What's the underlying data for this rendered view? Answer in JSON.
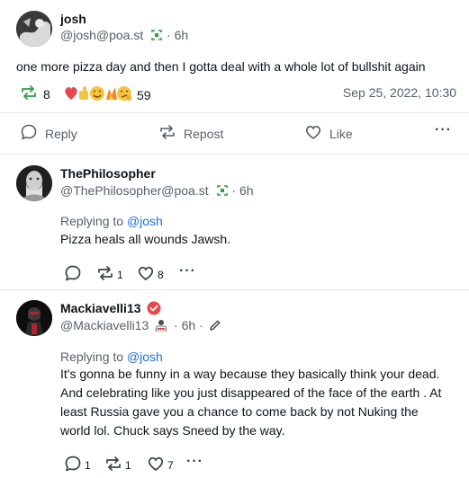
{
  "main_post": {
    "author_name": "josh",
    "author_handle": "@josh@poa.st",
    "age": "· 6h",
    "text": "one more pizza day and then I gotta deal with a whole lot of bullshit again",
    "repost_count": "8",
    "reaction_count": "59",
    "timestamp": "Sep 25, 2022, 10:30",
    "actions": {
      "reply": "Reply",
      "repost": "Repost",
      "like": "Like"
    }
  },
  "replies": [
    {
      "author_name": "ThePhilosopher",
      "author_handle": "@ThePhilosopher@poa.st",
      "age": "· 6h",
      "replying_prefix": "Replying to ",
      "replying_to": "@josh",
      "text": "Pizza heals all wounds Jawsh.",
      "reply_count": "",
      "repost_count": "1",
      "like_count": "8"
    },
    {
      "author_name": "Mackiavelli13",
      "author_handle": "@Mackiavelli13",
      "age": "· 6h ·",
      "replying_prefix": "Replying to ",
      "replying_to": "@josh",
      "text_lines": [
        "It's gonna be funny in a way because they basically think your dead.",
        "And celebrating like you just disappeared of the face of the earth . At",
        "least Russia gave you a chance to come back by not Nuking the",
        "world lol. Chuck says Sneed by the way."
      ],
      "reply_count": "1",
      "repost_count": "1",
      "like_count": "7"
    }
  ],
  "colors": {
    "repost_green": "#2f9e44",
    "link_blue": "#1d6fe0",
    "verified_red": "#e5484d"
  }
}
